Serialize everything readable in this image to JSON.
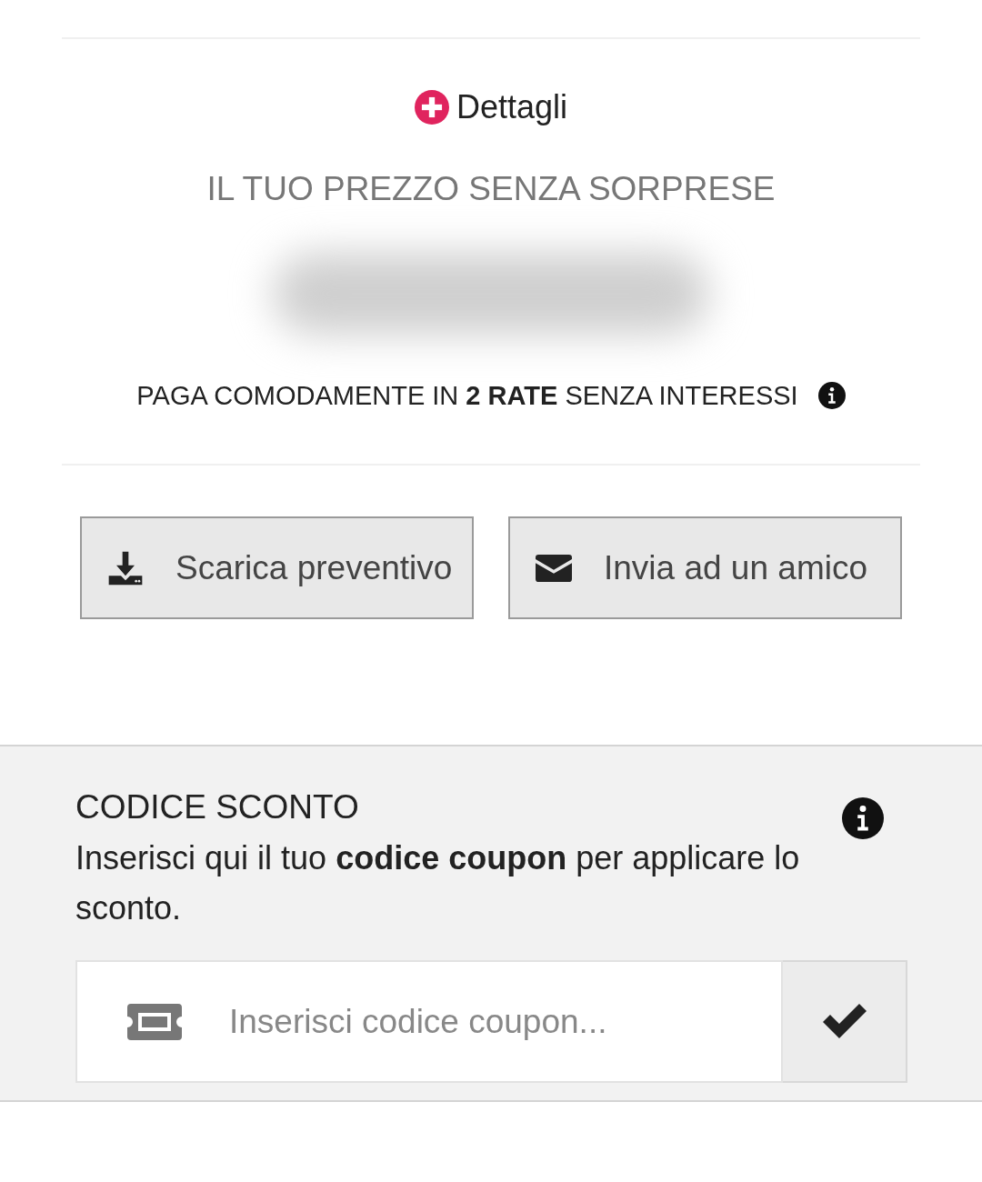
{
  "details_toggle": {
    "label": "Dettagli",
    "expanded": false
  },
  "price_heading": "IL TUO PREZZO SENZA SORPRESE",
  "price": {
    "kind": "blurred"
  },
  "installments": "PAGA COMODAMENTE IN **2 RATE** SENZA INTERESSI",
  "actions": [
    {
      "kind": "download",
      "label": "Scarica preventivo"
    },
    {
      "kind": "mail",
      "label": "Invia ad un amico"
    }
  ],
  "coupon": {
    "title": "CODICE SCONTO",
    "description": "Inserisci qui il tuo **codice coupon** per applicare lo sconto.",
    "placeholder": "Inserisci codice coupon..."
  }
}
